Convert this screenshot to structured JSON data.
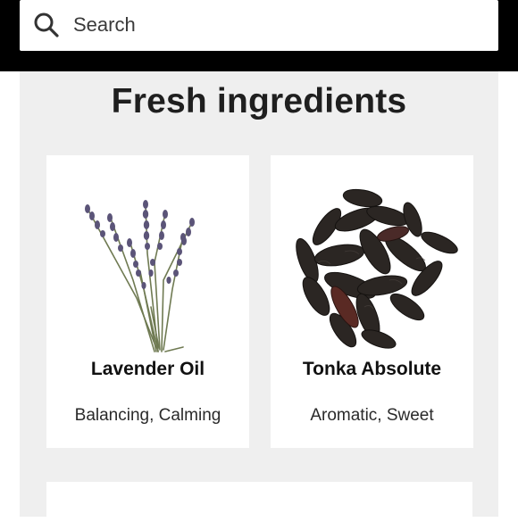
{
  "search": {
    "placeholder": "Search",
    "icon": "search-icon"
  },
  "section": {
    "title": "Fresh ingredients"
  },
  "ingredients": [
    {
      "name": "Lavender Oil",
      "description": "Balancing, Calming",
      "image": "lavender-sprigs"
    },
    {
      "name": "Tonka Absolute",
      "description": "Aromatic, Sweet",
      "image": "tonka-beans"
    }
  ],
  "colors": {
    "topbar": "#000000",
    "panel": "#efefef",
    "card": "#ffffff",
    "title_text": "#1f1f1f"
  }
}
